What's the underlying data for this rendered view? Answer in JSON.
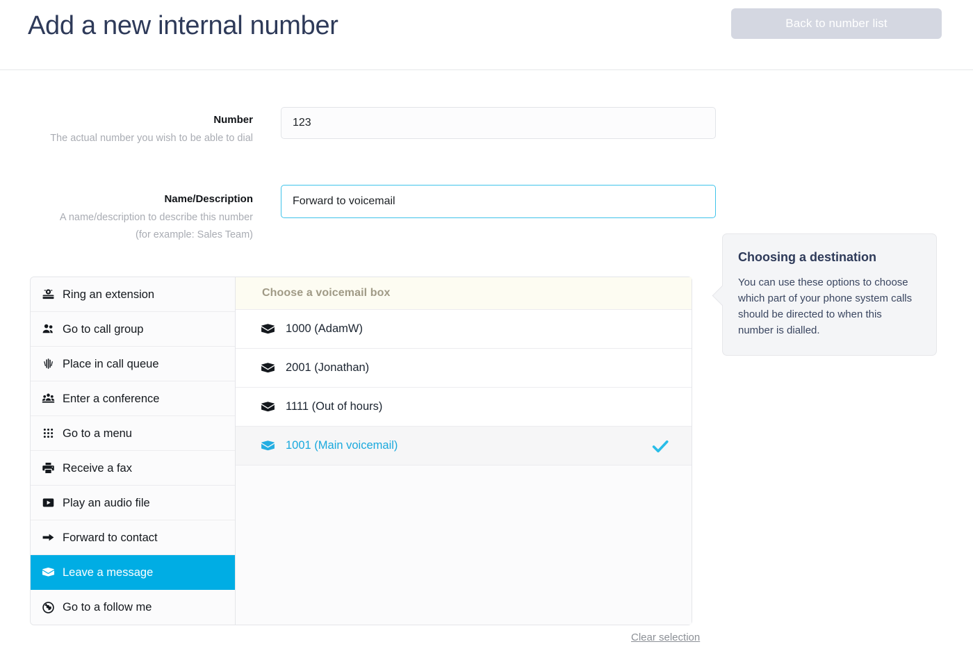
{
  "header": {
    "title": "Add a new internal number",
    "back_button_label": "Back to number list"
  },
  "form": {
    "number": {
      "label": "Number",
      "help": "The actual number you wish to be able to dial",
      "value": "123",
      "placeholder": ""
    },
    "name": {
      "label": "Name/Description",
      "help": "A name/description to describe this number (for example: Sales Team)",
      "value": "Forward to voicemail",
      "placeholder": "",
      "focused": true
    }
  },
  "destination_options": [
    {
      "label": "Ring an extension",
      "icon": "telephone-icon",
      "selected": false
    },
    {
      "label": "Go to call group",
      "icon": "users-icon",
      "selected": false
    },
    {
      "label": "Place in call queue",
      "icon": "signal-bars-icon",
      "selected": false
    },
    {
      "label": "Enter a conference",
      "icon": "conference-icon",
      "selected": false
    },
    {
      "label": "Go to a menu",
      "icon": "grid-dots-icon",
      "selected": false
    },
    {
      "label": "Receive a fax",
      "icon": "printer-icon",
      "selected": false
    },
    {
      "label": "Play an audio file",
      "icon": "play-box-icon",
      "selected": false
    },
    {
      "label": "Forward to contact",
      "icon": "arrow-right-icon",
      "selected": false
    },
    {
      "label": "Leave a message",
      "icon": "envelope-icon",
      "selected": true
    },
    {
      "label": "Go to a follow me",
      "icon": "globe-icon",
      "selected": false
    }
  ],
  "voicemail_panel": {
    "heading": "Choose a voicemail box",
    "items": [
      {
        "label": "1000 (AdamW)",
        "icon": "envelope-icon",
        "selected": false
      },
      {
        "label": "2001 (Jonathan)",
        "icon": "envelope-icon",
        "selected": false
      },
      {
        "label": "1111 (Out of hours)",
        "icon": "envelope-icon",
        "selected": false
      },
      {
        "label": "1001 (Main voicemail)",
        "icon": "envelope-icon",
        "selected": true
      }
    ],
    "check_icon": "check-icon"
  },
  "clear_selection_label": "Clear selection",
  "tooltip": {
    "title": "Choosing a destination",
    "body": "You can use these options to choose which part of your phone system calls should be directed to when this number is dialled."
  },
  "colors": {
    "accent_cyan": "#00ade4",
    "title_navy": "#2e3a59",
    "button_grey": "#d4d7e1",
    "heading_cream_bg": "#fdfcf2"
  }
}
